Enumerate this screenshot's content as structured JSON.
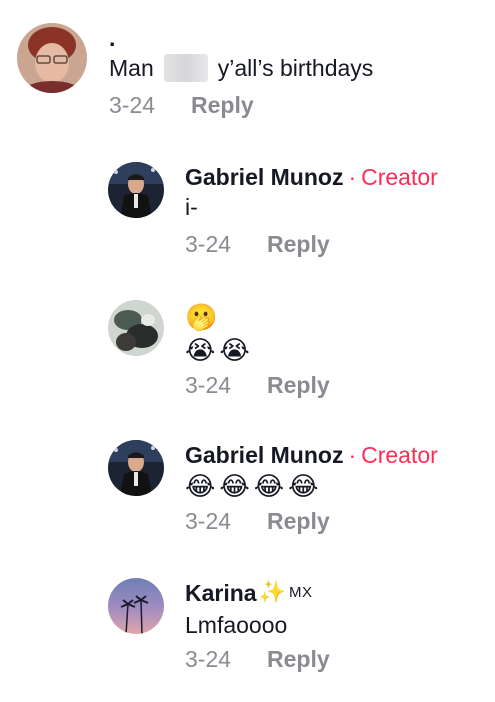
{
  "comments": [
    {
      "username": ".",
      "text_before": "Man",
      "text_after": "y’all’s birthdays",
      "date": "3-24",
      "reply_label": "Reply"
    },
    {
      "username": "Gabriel Munoz",
      "creator_sep": "·",
      "creator_label": "Creator",
      "text": "i-",
      "date": "3-24",
      "reply_label": "Reply"
    },
    {
      "emoji_line1": [
        "🫢"
      ],
      "emoji_line2": [
        "😭",
        "😭"
      ],
      "date": "3-24",
      "reply_label": "Reply"
    },
    {
      "username": "Gabriel Munoz",
      "creator_sep": "·",
      "creator_label": "Creator",
      "emojis": [
        "😂",
        "😂",
        "😂",
        "😂"
      ],
      "date": "3-24",
      "reply_label": "Reply"
    },
    {
      "username": "Karina",
      "username_emoji": "✨",
      "username_suffix": "MX",
      "text": "Lmfaoooo",
      "date": "3-24",
      "reply_label": "Reply"
    }
  ],
  "colors": {
    "creator": "#fe2c55",
    "meta": "#8a8b91",
    "text": "#161823"
  }
}
